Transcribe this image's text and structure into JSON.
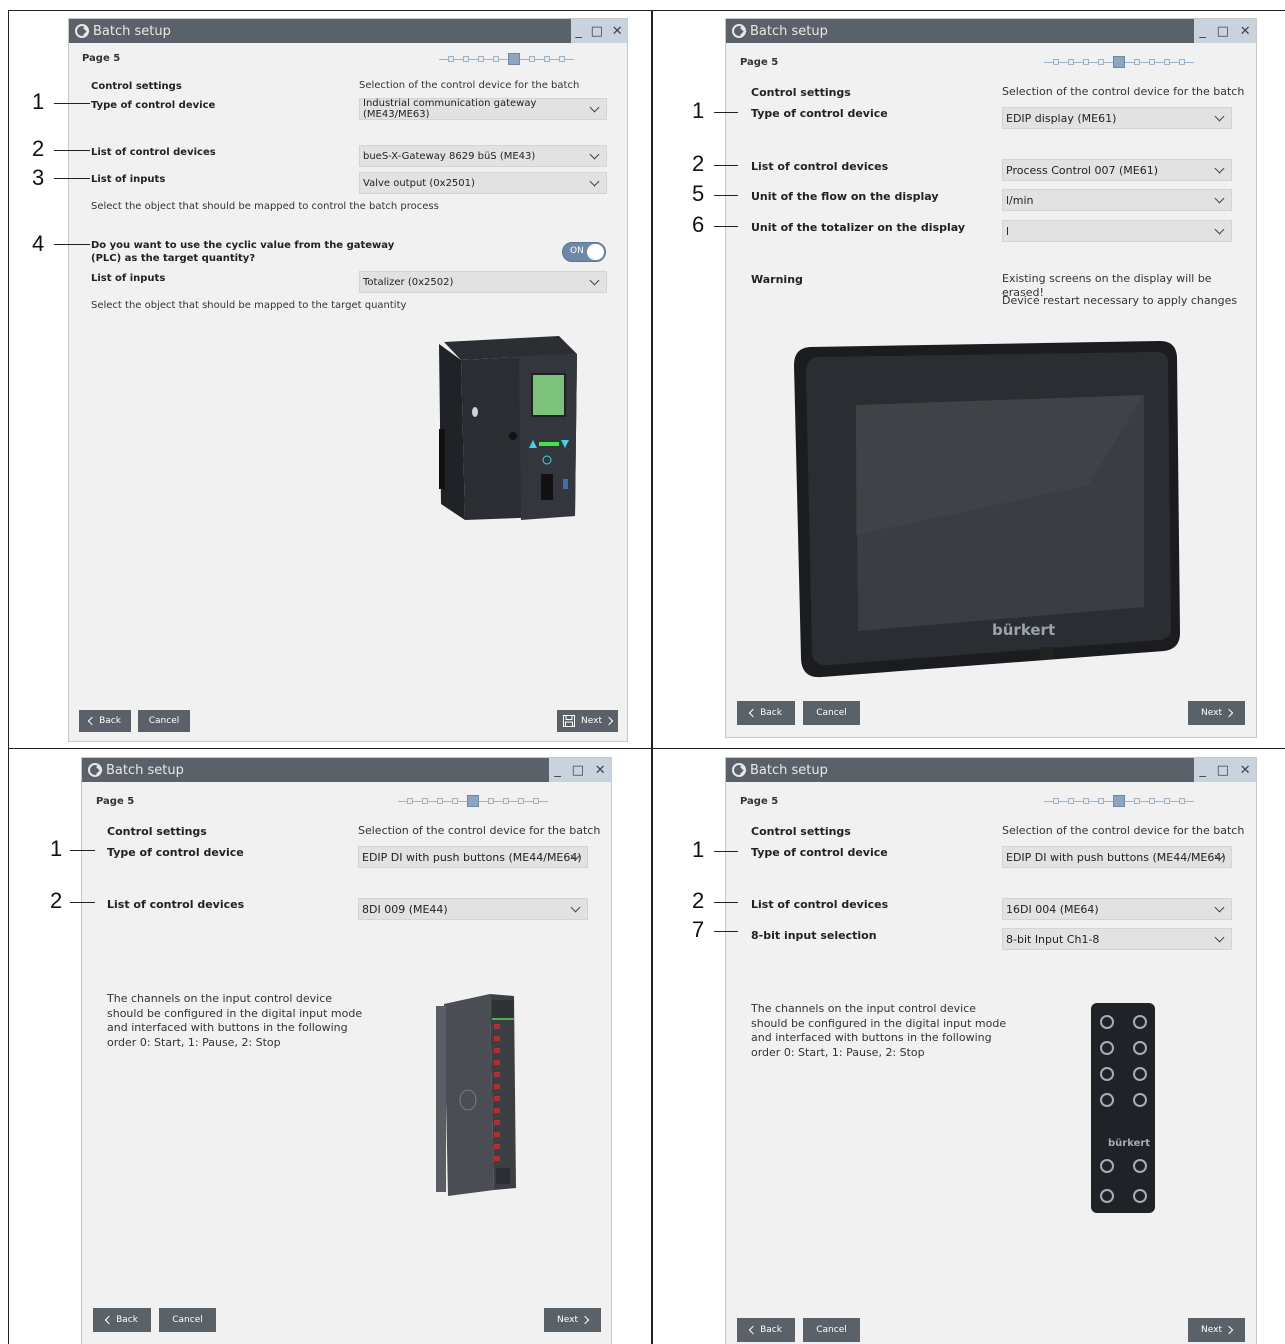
{
  "panels": [
    {
      "window_title": "Batch setup",
      "page_label": "Page 5",
      "win_controls": [
        "_",
        "□",
        "✕"
      ],
      "section_heading": "Control settings",
      "section_desc": "Selection of the control device for the batch",
      "rows": [
        {
          "callout": "1",
          "label": "Type of control device",
          "value": "Industrial communication gateway (ME43/ME63)"
        },
        {
          "callout": "2",
          "label": "List of control devices",
          "value": "bueS-X-Gateway 8629 büS (ME43)"
        },
        {
          "callout": "3",
          "label": "List of inputs",
          "value": "Valve output (0x2501)"
        }
      ],
      "hint1": "Select the object that should be mapped to control the batch process",
      "question_callout": "4",
      "question_line1": "Do you want to use the cyclic value from the gateway",
      "question_line2": "(PLC) as the target quantity?",
      "toggle": "ON",
      "inputs2_label": "List of inputs",
      "inputs2_value": "Totalizer (0x2502)",
      "hint2": "Select the object that should be mapped to the target quantity",
      "back": "Back",
      "cancel": "Cancel",
      "next": "Next"
    },
    {
      "window_title": "Batch setup",
      "page_label": "Page 5",
      "win_controls": [
        "_",
        "□",
        "✕"
      ],
      "section_heading": "Control settings",
      "section_desc": "Selection of the control device for the batch",
      "rows": [
        {
          "callout": "1",
          "label": "Type of control device",
          "value": "EDIP display (ME61)"
        },
        {
          "callout": "2",
          "label": "List of control devices",
          "value": "Process Control 007 (ME61)"
        },
        {
          "callout": "5",
          "label": "Unit of the flow on the display",
          "value": "l/min"
        },
        {
          "callout": "6",
          "label": "Unit of the totalizer on the display",
          "value": "l"
        }
      ],
      "warning_label": "Warning",
      "warning_line1": "Existing screens on the display will be erased!",
      "warning_line2": "Device restart necessary to apply changes",
      "device_brand": "bürkert",
      "back": "Back",
      "cancel": "Cancel",
      "next": "Next"
    },
    {
      "window_title": "Batch setup",
      "page_label": "Page 5",
      "win_controls": [
        "_",
        "□",
        "✕"
      ],
      "section_heading": "Control settings",
      "section_desc": "Selection of the control device for the batch",
      "rows": [
        {
          "callout": "1",
          "label": "Type of control device",
          "value": "EDIP DI with push buttons (ME44/ME64)"
        },
        {
          "callout": "2",
          "label": "List of control devices",
          "value": "8DI 009 (ME44)"
        }
      ],
      "note": [
        "The channels on the input control device",
        "should be configured in the digital input mode",
        "and interfaced with buttons in the following",
        "order 0: Start, 1: Pause, 2: Stop"
      ],
      "back": "Back",
      "cancel": "Cancel",
      "next": "Next"
    },
    {
      "window_title": "Batch setup",
      "page_label": "Page 5",
      "win_controls": [
        "_",
        "□",
        "✕"
      ],
      "section_heading": "Control settings",
      "section_desc": "Selection of the control device for the batch",
      "rows": [
        {
          "callout": "1",
          "label": "Type of control device",
          "value": "EDIP DI with push buttons (ME44/ME64)"
        },
        {
          "callout": "2",
          "label": "List of control devices",
          "value": "16DI 004 (ME64)"
        },
        {
          "callout": "7",
          "label": "8-bit input selection",
          "value": "8-bit Input Ch1-8"
        }
      ],
      "note": [
        "The channels on the input control device",
        "should be configured in the digital input mode",
        "and interfaced with buttons in the following",
        "order 0: Start, 1: Pause, 2: Stop"
      ],
      "device_brand": "bürkert",
      "back": "Back",
      "cancel": "Cancel",
      "next": "Next"
    }
  ]
}
